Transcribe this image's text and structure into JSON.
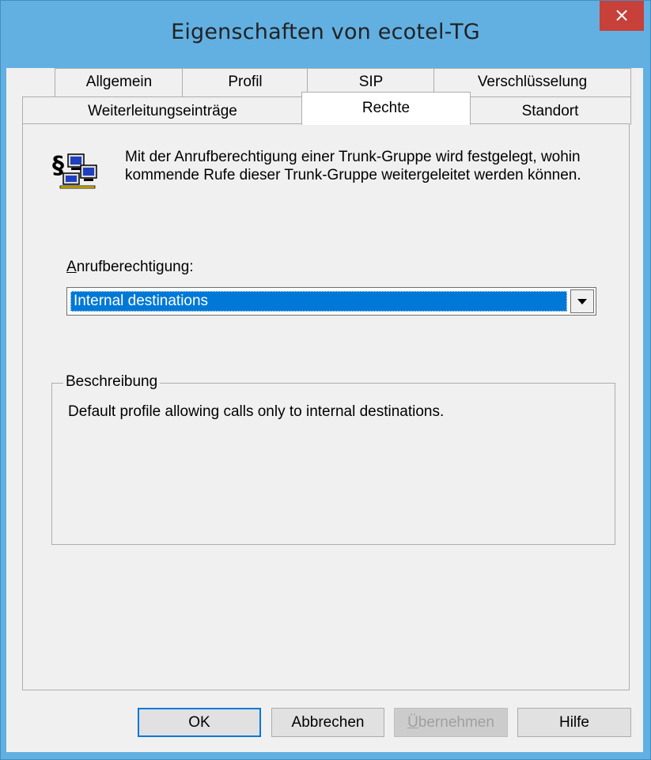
{
  "window": {
    "title": "Eigenschaften von ecotel-TG",
    "close_label": "×"
  },
  "tabs": {
    "row1": [
      {
        "label": "Allgemein"
      },
      {
        "label": "Profil"
      },
      {
        "label": "SIP"
      },
      {
        "label": "Verschlüsselung"
      }
    ],
    "row2": [
      {
        "label": "Weiterleitungseinträge"
      },
      {
        "label": "Rechte",
        "active": true
      },
      {
        "label": "Standort"
      }
    ]
  },
  "info_text": "Mit der Anrufberechtigung einer Trunk-Gruppe wird festgelegt, wohin kommende Rufe dieser Trunk-Gruppe weitergeleitet werden können.",
  "permission": {
    "label_accel": "A",
    "label_rest": "nrufberechtigung:",
    "selected": "Internal destinations"
  },
  "description": {
    "group_title": "Beschreibung",
    "text": "Default profile allowing calls only to internal destinations."
  },
  "buttons": {
    "ok": "OK",
    "cancel": "Abbrechen",
    "apply_accel": "Ü",
    "apply_rest": "bernehmen",
    "help": "Hilfe"
  }
}
